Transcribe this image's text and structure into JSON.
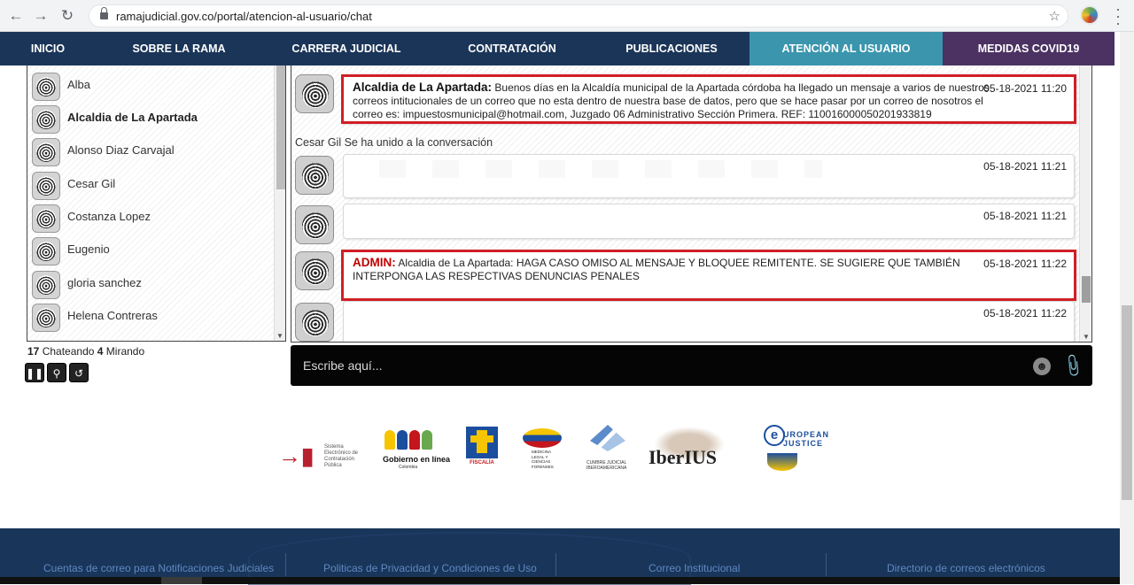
{
  "browser": {
    "url": "ramajudicial.gov.co/portal/atencion-al-usuario/chat",
    "back_icon": "arrow-left-icon",
    "forward_icon": "arrow-right-icon",
    "reload_icon": "reload-icon"
  },
  "nav": {
    "items": [
      {
        "label": "INICIO"
      },
      {
        "label": "SOBRE LA RAMA"
      },
      {
        "label": "CARRERA JUDICIAL"
      },
      {
        "label": "CONTRATACIÓN"
      },
      {
        "label": "PUBLICACIONES"
      },
      {
        "label": "ATENCIÓN AL USUARIO"
      },
      {
        "label": "MEDIDAS COVID19"
      }
    ],
    "colors": {
      "bar": "#1b3558",
      "active": "#3a95ad",
      "covid": "#4b3262"
    }
  },
  "users": {
    "items": [
      {
        "name": "Alba"
      },
      {
        "name": "Alcaldia de La Apartada"
      },
      {
        "name": "Alonso Diaz Carvajal"
      },
      {
        "name": "Cesar Gil"
      },
      {
        "name": "Costanza Lopez"
      },
      {
        "name": "Eugenio"
      },
      {
        "name": "gloria sanchez"
      },
      {
        "name": "Helena Contreras"
      }
    ],
    "chatting_count": "17",
    "chatting_label": "Chateando",
    "watching_count": "4",
    "watching_label": "Mirando"
  },
  "chat": {
    "messages": [
      {
        "sender": "Alcaldia de La Apartada:",
        "text": "Buenos días en la Alcaldía municipal de la Apartada córdoba ha llegado un mensaje a varios de nuestros correos intitucionales de un correo que no esta dentro de nuestra base de datos, pero que se hace pasar por un correo de nosotros el correo es: impuestosmunicipal@hotmail.com, Juzgado 06 Administrativo Sección Primera. REF: 11001600005020193381­9",
        "time": "05-18-2021 11:20"
      },
      {
        "system": "Cesar Gil Se ha unido a la conversación"
      },
      {
        "time": "05-18-2021 11:21"
      },
      {
        "time": "05-18-2021 11:21"
      },
      {
        "sender": "ADMIN:",
        "text": "Alcaldia de La Apartada: HAGA CASO OMISO AL MENSAJE Y BLOQUEE REMITENTE. SE SUGIERE QUE TAMBIÉN INTERPONGA LAS RESPECTIVAS DENUNCIAS PENALES",
        "time": "05-18-2021 11:22"
      },
      {
        "time": "05-18-2021 11:22"
      }
    ],
    "input_placeholder": "Escribe aquí...",
    "highlight_color": "#d11f26",
    "admin_color": "#c00000"
  },
  "logos": {
    "secop_text": "Sistema Electrónico de Contratación Pública",
    "gel_title": "Gobierno en línea",
    "gel_sub": "Colombia",
    "fiscalia": "FISCALÍA",
    "ml_text": "MEDICINA LEGAL Y CIENCIAS FORENSES",
    "cumbre_text": "CUMBRE JUDICIAL IBEROAMERICANA",
    "iberius": "IberIUS",
    "ej_text": "UROPEAN JUSTICE",
    "ej_letter": "e"
  },
  "footer": {
    "links": [
      {
        "label": "Cuentas de correo para Notificaciones Judiciales"
      },
      {
        "label": "Politicas de Privacidad y Condiciones de Uso"
      },
      {
        "label": "Correo Institucional"
      },
      {
        "label": "Directorio de correos electrónicos"
      }
    ]
  }
}
